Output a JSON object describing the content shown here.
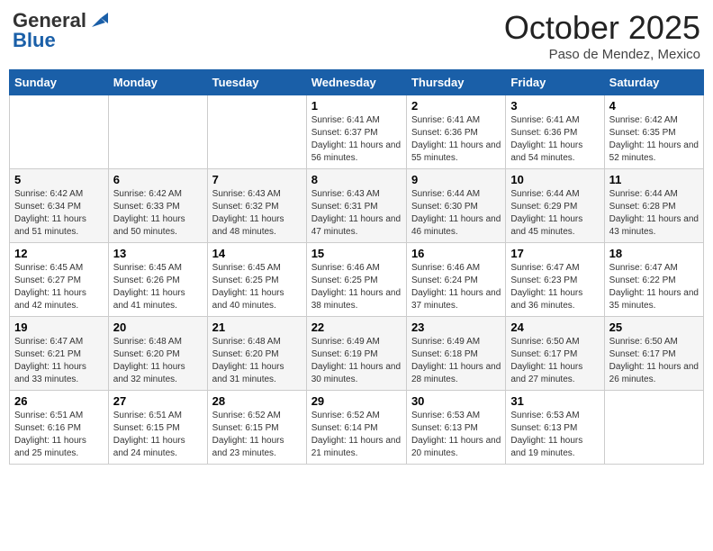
{
  "logo": {
    "line1": "General",
    "line2": "Blue"
  },
  "title": "October 2025",
  "subtitle": "Paso de Mendez, Mexico",
  "days_of_week": [
    "Sunday",
    "Monday",
    "Tuesday",
    "Wednesday",
    "Thursday",
    "Friday",
    "Saturday"
  ],
  "weeks": [
    [
      {
        "day": "",
        "info": ""
      },
      {
        "day": "",
        "info": ""
      },
      {
        "day": "",
        "info": ""
      },
      {
        "day": "1",
        "info": "Sunrise: 6:41 AM\nSunset: 6:37 PM\nDaylight: 11 hours and 56 minutes."
      },
      {
        "day": "2",
        "info": "Sunrise: 6:41 AM\nSunset: 6:36 PM\nDaylight: 11 hours and 55 minutes."
      },
      {
        "day": "3",
        "info": "Sunrise: 6:41 AM\nSunset: 6:36 PM\nDaylight: 11 hours and 54 minutes."
      },
      {
        "day": "4",
        "info": "Sunrise: 6:42 AM\nSunset: 6:35 PM\nDaylight: 11 hours and 52 minutes."
      }
    ],
    [
      {
        "day": "5",
        "info": "Sunrise: 6:42 AM\nSunset: 6:34 PM\nDaylight: 11 hours and 51 minutes."
      },
      {
        "day": "6",
        "info": "Sunrise: 6:42 AM\nSunset: 6:33 PM\nDaylight: 11 hours and 50 minutes."
      },
      {
        "day": "7",
        "info": "Sunrise: 6:43 AM\nSunset: 6:32 PM\nDaylight: 11 hours and 48 minutes."
      },
      {
        "day": "8",
        "info": "Sunrise: 6:43 AM\nSunset: 6:31 PM\nDaylight: 11 hours and 47 minutes."
      },
      {
        "day": "9",
        "info": "Sunrise: 6:44 AM\nSunset: 6:30 PM\nDaylight: 11 hours and 46 minutes."
      },
      {
        "day": "10",
        "info": "Sunrise: 6:44 AM\nSunset: 6:29 PM\nDaylight: 11 hours and 45 minutes."
      },
      {
        "day": "11",
        "info": "Sunrise: 6:44 AM\nSunset: 6:28 PM\nDaylight: 11 hours and 43 minutes."
      }
    ],
    [
      {
        "day": "12",
        "info": "Sunrise: 6:45 AM\nSunset: 6:27 PM\nDaylight: 11 hours and 42 minutes."
      },
      {
        "day": "13",
        "info": "Sunrise: 6:45 AM\nSunset: 6:26 PM\nDaylight: 11 hours and 41 minutes."
      },
      {
        "day": "14",
        "info": "Sunrise: 6:45 AM\nSunset: 6:25 PM\nDaylight: 11 hours and 40 minutes."
      },
      {
        "day": "15",
        "info": "Sunrise: 6:46 AM\nSunset: 6:25 PM\nDaylight: 11 hours and 38 minutes."
      },
      {
        "day": "16",
        "info": "Sunrise: 6:46 AM\nSunset: 6:24 PM\nDaylight: 11 hours and 37 minutes."
      },
      {
        "day": "17",
        "info": "Sunrise: 6:47 AM\nSunset: 6:23 PM\nDaylight: 11 hours and 36 minutes."
      },
      {
        "day": "18",
        "info": "Sunrise: 6:47 AM\nSunset: 6:22 PM\nDaylight: 11 hours and 35 minutes."
      }
    ],
    [
      {
        "day": "19",
        "info": "Sunrise: 6:47 AM\nSunset: 6:21 PM\nDaylight: 11 hours and 33 minutes."
      },
      {
        "day": "20",
        "info": "Sunrise: 6:48 AM\nSunset: 6:20 PM\nDaylight: 11 hours and 32 minutes."
      },
      {
        "day": "21",
        "info": "Sunrise: 6:48 AM\nSunset: 6:20 PM\nDaylight: 11 hours and 31 minutes."
      },
      {
        "day": "22",
        "info": "Sunrise: 6:49 AM\nSunset: 6:19 PM\nDaylight: 11 hours and 30 minutes."
      },
      {
        "day": "23",
        "info": "Sunrise: 6:49 AM\nSunset: 6:18 PM\nDaylight: 11 hours and 28 minutes."
      },
      {
        "day": "24",
        "info": "Sunrise: 6:50 AM\nSunset: 6:17 PM\nDaylight: 11 hours and 27 minutes."
      },
      {
        "day": "25",
        "info": "Sunrise: 6:50 AM\nSunset: 6:17 PM\nDaylight: 11 hours and 26 minutes."
      }
    ],
    [
      {
        "day": "26",
        "info": "Sunrise: 6:51 AM\nSunset: 6:16 PM\nDaylight: 11 hours and 25 minutes."
      },
      {
        "day": "27",
        "info": "Sunrise: 6:51 AM\nSunset: 6:15 PM\nDaylight: 11 hours and 24 minutes."
      },
      {
        "day": "28",
        "info": "Sunrise: 6:52 AM\nSunset: 6:15 PM\nDaylight: 11 hours and 23 minutes."
      },
      {
        "day": "29",
        "info": "Sunrise: 6:52 AM\nSunset: 6:14 PM\nDaylight: 11 hours and 21 minutes."
      },
      {
        "day": "30",
        "info": "Sunrise: 6:53 AM\nSunset: 6:13 PM\nDaylight: 11 hours and 20 minutes."
      },
      {
        "day": "31",
        "info": "Sunrise: 6:53 AM\nSunset: 6:13 PM\nDaylight: 11 hours and 19 minutes."
      },
      {
        "day": "",
        "info": ""
      }
    ]
  ]
}
